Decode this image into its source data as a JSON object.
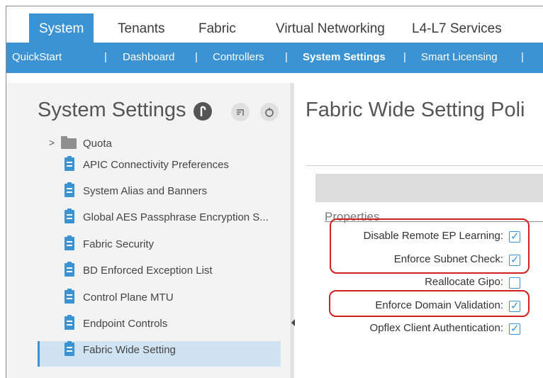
{
  "top_tabs": [
    {
      "label": "System",
      "active": true
    },
    {
      "label": "Tenants",
      "active": false
    },
    {
      "label": "Fabric",
      "active": false
    },
    {
      "label": "Virtual Networking",
      "active": false
    },
    {
      "label": "L4-L7 Services",
      "active": false
    }
  ],
  "sub_tabs": [
    {
      "label": "QuickStart",
      "active": false
    },
    {
      "label": "Dashboard",
      "active": false
    },
    {
      "label": "Controllers",
      "active": false
    },
    {
      "label": "System Settings",
      "active": true
    },
    {
      "label": "Smart Licensing",
      "active": false
    }
  ],
  "separator": "|",
  "left_panel": {
    "title": "System Settings",
    "tree_arrow": ">",
    "folder": "Quota",
    "items": [
      "APIC Connectivity Preferences",
      "System Alias and Banners",
      "Global AES Passphrase Encryption S...",
      "Fabric Security",
      "BD Enforced Exception List",
      "Control Plane MTU",
      "Endpoint Controls",
      "Fabric Wide Setting"
    ],
    "selected": "Fabric Wide Setting"
  },
  "right_panel": {
    "title": "Fabric Wide Setting Poli",
    "section_label": "Properties",
    "fields": [
      {
        "label": "Disable Remote EP Learning:",
        "checked": true
      },
      {
        "label": "Enforce Subnet Check:",
        "checked": true
      },
      {
        "label": "Reallocate Gipo:",
        "checked": false
      },
      {
        "label": "Enforce Domain Validation:",
        "checked": true
      },
      {
        "label": "Opflex Client Authentication:",
        "checked": true
      }
    ]
  },
  "colors": {
    "accent": "#3b93d4",
    "highlight": "#d21f1f"
  }
}
